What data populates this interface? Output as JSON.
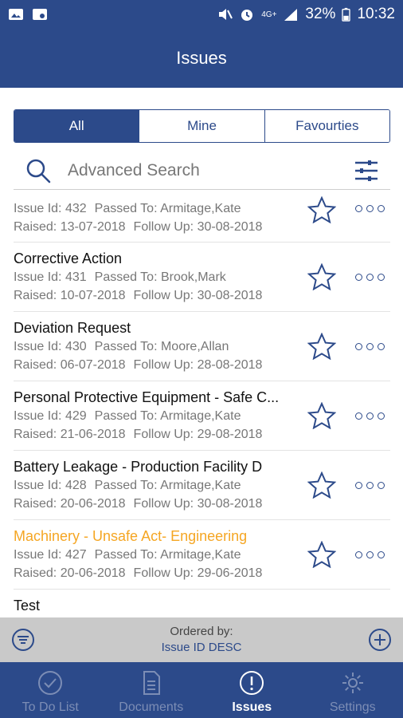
{
  "status_bar": {
    "battery": "32%",
    "time": "10:32",
    "network": "4G+"
  },
  "header": {
    "title": "Issues"
  },
  "segments": [
    {
      "label": "All",
      "active": true
    },
    {
      "label": "Mine",
      "active": false
    },
    {
      "label": "Favourties",
      "active": false
    }
  ],
  "search": {
    "placeholder": "Advanced Search"
  },
  "labels": {
    "issue_id": "Issue Id:",
    "passed_to": "Passed To:",
    "raised": "Raised:",
    "follow_up": "Follow Up:"
  },
  "issues": [
    {
      "title": "",
      "id": "432",
      "passed_to": "Armitage,Kate",
      "raised": "13-07-2018",
      "follow_up": "30-08-2018"
    },
    {
      "title": "Corrective Action",
      "id": "431",
      "passed_to": "Brook,Mark",
      "raised": "10-07-2018",
      "follow_up": "30-08-2018"
    },
    {
      "title": "Deviation Request",
      "id": "430",
      "passed_to": "Moore,Allan",
      "raised": "06-07-2018",
      "follow_up": "28-08-2018"
    },
    {
      "title": "Personal Protective Equipment - Safe C...",
      "id": "429",
      "passed_to": "Armitage,Kate",
      "raised": "21-06-2018",
      "follow_up": "29-08-2018"
    },
    {
      "title": "Battery Leakage - Production Facility D",
      "id": "428",
      "passed_to": "Armitage,Kate",
      "raised": "20-06-2018",
      "follow_up": "30-08-2018"
    },
    {
      "title": "Machinery - Unsafe Act- Engineering",
      "id": "427",
      "passed_to": "Armitage,Kate",
      "raised": "20-06-2018",
      "follow_up": "29-06-2018",
      "highlight": true
    },
    {
      "title": "Test",
      "id": "",
      "passed_to": "",
      "raised": "",
      "follow_up": ""
    }
  ],
  "order": {
    "label": "Ordered by:",
    "value": "Issue ID DESC"
  },
  "tabs": [
    {
      "label": "To Do List",
      "icon": "check-circle-icon",
      "active": false
    },
    {
      "label": "Documents",
      "icon": "document-icon",
      "active": false
    },
    {
      "label": "Issues",
      "icon": "exclamation-circle-icon",
      "active": true
    },
    {
      "label": "Settings",
      "icon": "gear-icon",
      "active": false
    }
  ],
  "colors": {
    "primary": "#2c4a8a",
    "highlight": "#f5a623",
    "order_bar": "#c9c9c9"
  }
}
